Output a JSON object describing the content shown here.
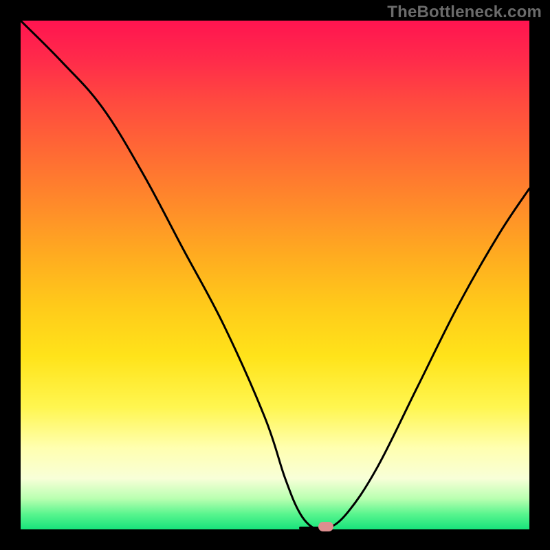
{
  "watermark": "TheBottleneck.com",
  "chart_data": {
    "type": "line",
    "title": "",
    "xlabel": "",
    "ylabel": "",
    "xlim": [
      0,
      100
    ],
    "ylim": [
      0,
      100
    ],
    "series": [
      {
        "name": "bottleneck-curve",
        "x": [
          0,
          8,
          16,
          24,
          32,
          40,
          48,
          52,
          55,
          58,
          60,
          64,
          70,
          78,
          86,
          94,
          100
        ],
        "values": [
          100,
          92,
          83,
          70,
          55,
          40,
          22,
          10,
          3,
          0,
          0,
          3,
          12,
          28,
          44,
          58,
          67
        ]
      }
    ],
    "flat_bottom": {
      "x_start": 55,
      "x_end": 60,
      "y": 0
    },
    "marker": {
      "x": 60,
      "y": 0
    },
    "annotations": []
  },
  "colors": {
    "background_frame": "#000000",
    "curve": "#000000",
    "marker": "#dd8e8f",
    "watermark": "#6b6b6b"
  }
}
